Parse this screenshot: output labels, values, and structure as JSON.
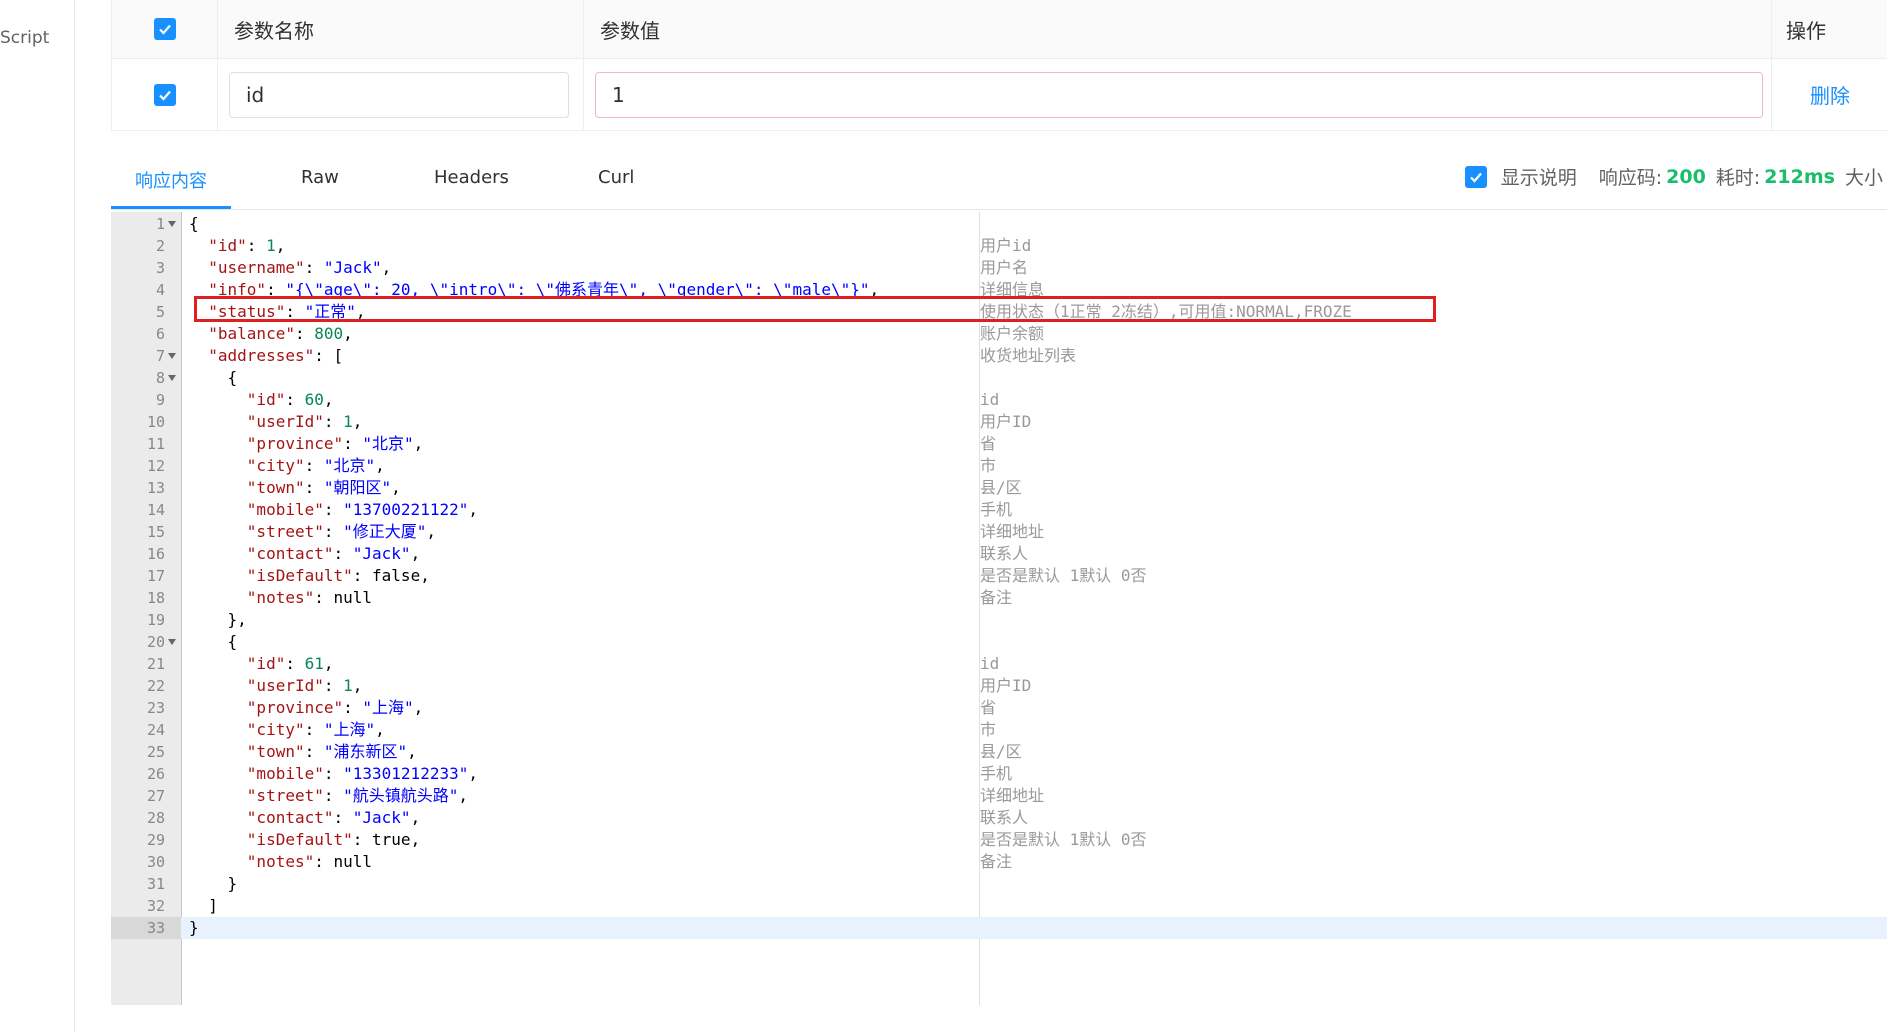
{
  "sidebar": {
    "partial_label": "Script"
  },
  "params_table": {
    "headers": {
      "name": "参数名称",
      "value": "参数值",
      "operation": "操作"
    },
    "rows": [
      {
        "name": "id",
        "value": "1",
        "delete_label": "删除"
      }
    ]
  },
  "tabs": [
    {
      "label": "响应内容",
      "active": true
    },
    {
      "label": "Raw",
      "active": false
    },
    {
      "label": "Headers",
      "active": false
    },
    {
      "label": "Curl",
      "active": false
    }
  ],
  "response_meta": {
    "show_desc_label": "显示说明",
    "show_desc_checked": true,
    "code_label": "响应码:",
    "code_value": "200",
    "time_label": "耗时:",
    "time_value": "212ms",
    "size_label": "大小"
  },
  "editor": {
    "lines": [
      {
        "n": 1,
        "fold": true,
        "code": "{",
        "comment": ""
      },
      {
        "n": 2,
        "code": "  \"id\": 1,",
        "comment": "用户id"
      },
      {
        "n": 3,
        "code": "  \"username\": \"Jack\",",
        "comment": "用户名"
      },
      {
        "n": 4,
        "code": "  \"info\": \"{\\\"age\\\": 20, \\\"intro\\\": \\\"佛系青年\\\", \\\"gender\\\": \\\"male\\\"}\",",
        "comment": "详细信息"
      },
      {
        "n": 5,
        "code": "  \"status\": \"正常\",",
        "comment": "使用状态（1正常 2冻结）,可用值:NORMAL,FROZE"
      },
      {
        "n": 6,
        "code": "  \"balance\": 800,",
        "comment": "账户余额"
      },
      {
        "n": 7,
        "fold": true,
        "code": "  \"addresses\": [",
        "comment": "收货地址列表"
      },
      {
        "n": 8,
        "fold": true,
        "code": "    {",
        "comment": ""
      },
      {
        "n": 9,
        "code": "      \"id\": 60,",
        "comment": "id"
      },
      {
        "n": 10,
        "code": "      \"userId\": 1,",
        "comment": "用户ID"
      },
      {
        "n": 11,
        "code": "      \"province\": \"北京\",",
        "comment": "省"
      },
      {
        "n": 12,
        "code": "      \"city\": \"北京\",",
        "comment": "市"
      },
      {
        "n": 13,
        "code": "      \"town\": \"朝阳区\",",
        "comment": "县/区"
      },
      {
        "n": 14,
        "code": "      \"mobile\": \"13700221122\",",
        "comment": "手机"
      },
      {
        "n": 15,
        "code": "      \"street\": \"修正大厦\",",
        "comment": "详细地址"
      },
      {
        "n": 16,
        "code": "      \"contact\": \"Jack\",",
        "comment": "联系人"
      },
      {
        "n": 17,
        "code": "      \"isDefault\": false,",
        "comment": "是否是默认 1默认 0否"
      },
      {
        "n": 18,
        "code": "      \"notes\": null",
        "comment": "备注"
      },
      {
        "n": 19,
        "code": "    },",
        "comment": ""
      },
      {
        "n": 20,
        "fold": true,
        "code": "    {",
        "comment": ""
      },
      {
        "n": 21,
        "code": "      \"id\": 61,",
        "comment": "id"
      },
      {
        "n": 22,
        "code": "      \"userId\": 1,",
        "comment": "用户ID"
      },
      {
        "n": 23,
        "code": "      \"province\": \"上海\",",
        "comment": "省"
      },
      {
        "n": 24,
        "code": "      \"city\": \"上海\",",
        "comment": "市"
      },
      {
        "n": 25,
        "code": "      \"town\": \"浦东新区\",",
        "comment": "县/区"
      },
      {
        "n": 26,
        "code": "      \"mobile\": \"13301212233\",",
        "comment": "手机"
      },
      {
        "n": 27,
        "code": "      \"street\": \"航头镇航头路\",",
        "comment": "详细地址"
      },
      {
        "n": 28,
        "code": "      \"contact\": \"Jack\",",
        "comment": "联系人"
      },
      {
        "n": 29,
        "code": "      \"isDefault\": true,",
        "comment": "是否是默认 1默认 0否"
      },
      {
        "n": 30,
        "code": "      \"notes\": null",
        "comment": "备注"
      },
      {
        "n": 31,
        "code": "    }",
        "comment": ""
      },
      {
        "n": 32,
        "code": "  ]",
        "comment": ""
      },
      {
        "n": 33,
        "code": "}",
        "comment": "",
        "active": true
      }
    ]
  },
  "colors": {
    "accent": "#1890ff",
    "success": "#19be6b",
    "highlight_border": "#e02020"
  }
}
